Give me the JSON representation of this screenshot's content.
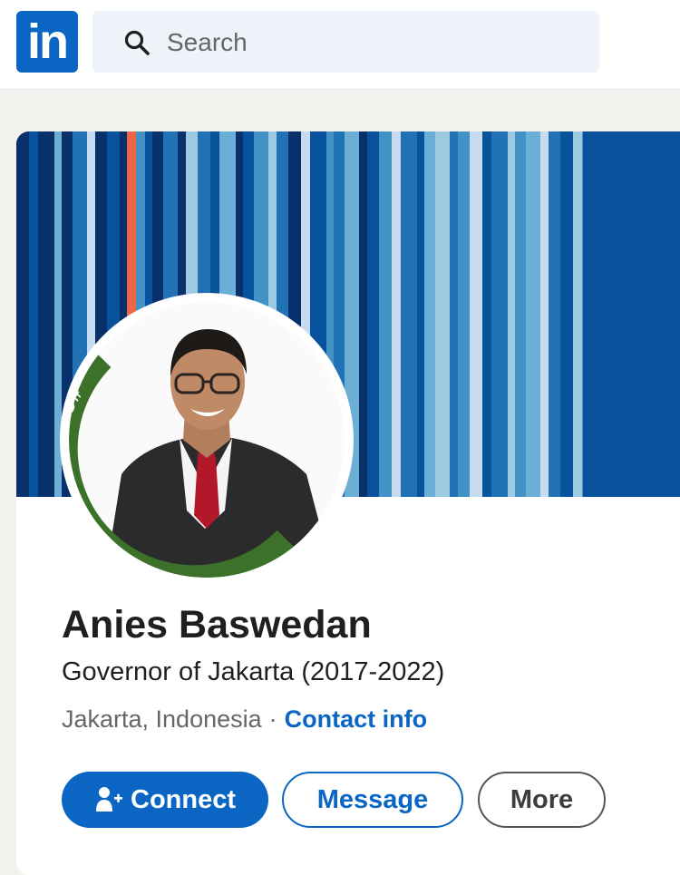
{
  "header": {
    "logo_text": "in",
    "search": {
      "placeholder": "Search",
      "icon": "search-icon"
    }
  },
  "profile": {
    "name": "Anies Baswedan",
    "headline": "Governor of Jakarta (2017-2022)",
    "location": "Jakarta, Indonesia",
    "separator": "·",
    "contact_link": "Contact info",
    "badge": "#OPENTOWORK",
    "banner_colors": [
      "#08306b",
      "#08519c",
      "#2171b5",
      "#4292c6",
      "#6baed6",
      "#9ecae1",
      "#c6dbef",
      "#ef6548"
    ]
  },
  "actions": {
    "connect": "Connect",
    "message": "Message",
    "more": "More"
  },
  "colors": {
    "brand": "#0a66c2",
    "badge_green": "#3c7129"
  }
}
